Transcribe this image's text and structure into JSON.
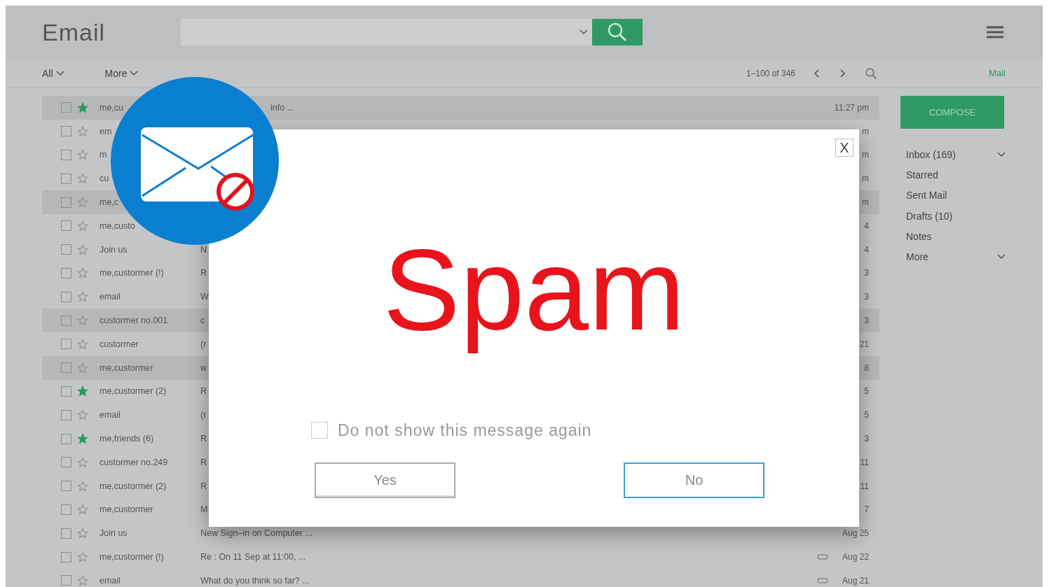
{
  "app": {
    "title": "Email"
  },
  "toolbar": {
    "filters": [
      {
        "label": "All"
      },
      {
        "label": "More"
      }
    ],
    "pagination": "1–100 of 346",
    "app_link": "Mail"
  },
  "messages": [
    {
      "sender": "me,cu",
      "subject": "info ...",
      "time": "11:27 pm",
      "starred": true,
      "highlighted": true,
      "attachment": false
    },
    {
      "sender": "em",
      "time": "m",
      "starred": false,
      "highlighted": false,
      "attachment": false
    },
    {
      "sender": "m",
      "time": "m",
      "starred": false,
      "highlighted": false,
      "attachment": false
    },
    {
      "sender": "cu",
      "time": "m",
      "starred": false,
      "highlighted": false,
      "attachment": false
    },
    {
      "sender": "me,c",
      "time": "m",
      "starred": false,
      "highlighted": true,
      "attachment": false
    },
    {
      "sender": "me,custo",
      "time": "4",
      "starred": false,
      "highlighted": false,
      "attachment": false
    },
    {
      "sender": "Join us",
      "subject": "N",
      "time": "4",
      "starred": false,
      "highlighted": false,
      "attachment": false
    },
    {
      "sender": "me,custormer (!)",
      "subject": "R",
      "time": "3",
      "starred": false,
      "highlighted": false,
      "attachment": false
    },
    {
      "sender": "email",
      "subject": "W",
      "time": "3",
      "starred": false,
      "highlighted": false,
      "attachment": false
    },
    {
      "sender": "custormer no.001",
      "subject": "c",
      "time": "3",
      "starred": false,
      "highlighted": true,
      "attachment": false
    },
    {
      "sender": "custormer",
      "subject": "(r",
      "time": "21",
      "starred": false,
      "highlighted": false,
      "attachment": false
    },
    {
      "sender": "me,custormer",
      "subject": "w",
      "time": "8",
      "starred": false,
      "highlighted": true,
      "attachment": false
    },
    {
      "sender": "me,custormer (2)",
      "subject": "R",
      "time": "5",
      "starred": true,
      "highlighted": false,
      "attachment": false
    },
    {
      "sender": "email",
      "subject": "(r",
      "time": "5",
      "starred": false,
      "highlighted": false,
      "attachment": false
    },
    {
      "sender": "me,friends (6)",
      "subject": "R",
      "time": "3",
      "starred": true,
      "highlighted": false,
      "attachment": false
    },
    {
      "sender": "custormer no.249",
      "subject": "R",
      "time": "11",
      "starred": false,
      "highlighted": false,
      "attachment": false
    },
    {
      "sender": "me,custormer (2)",
      "subject": "R",
      "time": "11",
      "starred": false,
      "highlighted": false,
      "attachment": false
    },
    {
      "sender": "me,custormer",
      "subject": "M",
      "time": "7",
      "starred": false,
      "highlighted": false,
      "attachment": false
    },
    {
      "sender": "Join us",
      "subject": "New Sign–in on Computer ...",
      "time": "Aug 25",
      "starred": false,
      "highlighted": false,
      "attachment": false
    },
    {
      "sender": "me,custormer (!)",
      "subject": "Re : On 11 Sep at 11:00, ...",
      "time": "Aug 22",
      "starred": false,
      "highlighted": false,
      "attachment": true
    },
    {
      "sender": "email",
      "subject": "What do you think so far? ...",
      "time": "Aug 21",
      "starred": false,
      "highlighted": false,
      "attachment": true
    }
  ],
  "sidebar": {
    "compose": "COMPOSE",
    "items": [
      {
        "label": "Inbox (169)",
        "expandable": true
      },
      {
        "label": "Starred",
        "expandable": false
      },
      {
        "label": "Sent Mail",
        "expandable": false
      },
      {
        "label": "Drafts (10)",
        "expandable": false
      },
      {
        "label": "Notes",
        "expandable": false
      },
      {
        "label": "More",
        "expandable": true
      }
    ]
  },
  "dialog": {
    "title": "Spam",
    "close": "X",
    "checkbox": {
      "label": "Do not show this message again",
      "checked": false
    },
    "buttons": [
      {
        "label": "Yes",
        "focused": false
      },
      {
        "label": "No",
        "focused": true
      }
    ]
  }
}
